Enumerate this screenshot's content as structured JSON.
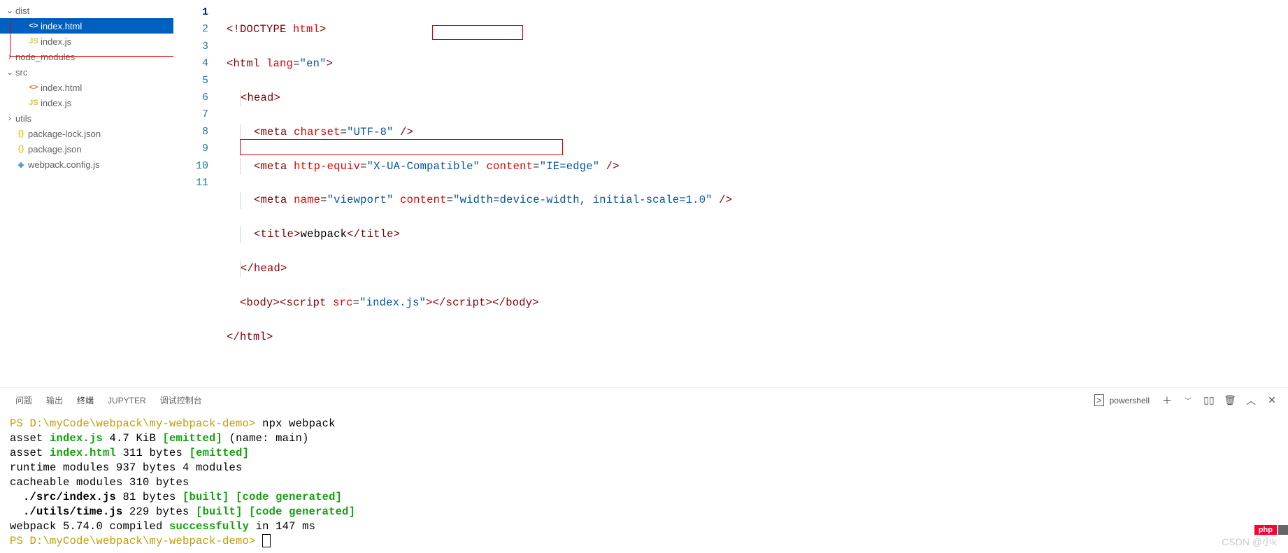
{
  "sidebar": {
    "items": [
      {
        "type": "folder",
        "label": "dist",
        "expanded": true,
        "indent": 0
      },
      {
        "type": "file",
        "label": "index.html",
        "icon": "html",
        "indent": 1,
        "selected": true
      },
      {
        "type": "file",
        "label": "index.js",
        "icon": "js",
        "indent": 1
      },
      {
        "type": "folder",
        "label": "node_modules",
        "expanded": false,
        "indent": 0
      },
      {
        "type": "folder",
        "label": "src",
        "expanded": true,
        "indent": 0
      },
      {
        "type": "file",
        "label": "index.html",
        "icon": "html",
        "indent": 1
      },
      {
        "type": "file",
        "label": "index.js",
        "icon": "js",
        "indent": 1
      },
      {
        "type": "folder",
        "label": "utils",
        "expanded": false,
        "indent": 0
      },
      {
        "type": "file",
        "label": "package-lock.json",
        "icon": "json",
        "indent": 0,
        "rootfile": true
      },
      {
        "type": "file",
        "label": "package.json",
        "icon": "json",
        "indent": 0,
        "rootfile": true
      },
      {
        "type": "file",
        "label": "webpack.config.js",
        "icon": "webpack",
        "indent": 0,
        "rootfile": true
      }
    ]
  },
  "editor": {
    "active_line": 1,
    "lines": [
      "1",
      "2",
      "3",
      "4",
      "5",
      "6",
      "7",
      "8",
      "9",
      "10",
      "11"
    ],
    "code": {
      "l1": {
        "doctype": "<!DOCTYPE ",
        "name": "html",
        "close": ">"
      },
      "l2": {
        "open": "<",
        "tag": "html",
        "sp": " ",
        "attr": "lang",
        "eq": "=",
        "val": "\"en\"",
        "close": ">"
      },
      "l3": {
        "open": "<",
        "tag": "head",
        "close": ">"
      },
      "l4": {
        "open": "<",
        "tag": "meta",
        "sp": " ",
        "attr": "charset",
        "eq": "=",
        "val": "\"UTF-8\"",
        "close": " />"
      },
      "l5": {
        "open": "<",
        "tag": "meta",
        "sp": " ",
        "a1": "http-equiv",
        "e1": "=",
        "v1": "\"X-UA-Compatible\"",
        "sp2": " ",
        "a2": "content",
        "e2": "=",
        "v2": "\"IE=edge\"",
        "close": " />"
      },
      "l6": {
        "open": "<",
        "tag": "meta",
        "sp": " ",
        "a1": "name",
        "e1": "=",
        "v1": "\"viewport\"",
        "sp2": " ",
        "a2": "content",
        "e2": "=",
        "v2": "\"width=device-width, initial-scale=1.0\"",
        "close": " />"
      },
      "l7": {
        "open1": "<",
        "tag1": "title",
        "close1": ">",
        "text": "webpack",
        "open2": "</",
        "tag2": "title",
        "close2": ">"
      },
      "l8": {
        "open": "</",
        "tag": "head",
        "close": ">"
      },
      "l9": {
        "p1": "<",
        "t1": "body",
        "p2": "><",
        "t2": "script",
        "sp": " ",
        "a": "src",
        "e": "=",
        "v": "\"index.js\"",
        "p3": "></",
        "t3": "script",
        "p4": "></",
        "t4": "body",
        "p5": ">"
      },
      "l10": {
        "open": "</",
        "tag": "html",
        "close": ">"
      }
    }
  },
  "panel": {
    "tabs": [
      "问题",
      "输出",
      "终端",
      "JUPYTER",
      "调试控制台"
    ],
    "active_tab": 2,
    "shell_label": "powershell",
    "terminal": {
      "prompt1": "PS D:\\myCode\\webpack\\my-webpack-demo>",
      "cmd1": " npx webpack",
      "l2a": "asset ",
      "l2b": "index.js",
      "l2c": " 4.7 KiB ",
      "l2d": "[emitted]",
      "l2e": " (name: main)",
      "l3a": "asset ",
      "l3b": "index.html",
      "l3c": " 311 bytes ",
      "l3d": "[emitted]",
      "l4": "runtime modules 937 bytes 4 modules",
      "l5": "cacheable modules 310 bytes",
      "l6a": "  ./src/index.js",
      "l6b": " 81 bytes ",
      "l6c": "[built]",
      "l6d": " ",
      "l6e": "[code generated]",
      "l7a": "  ./utils/time.js",
      "l7b": " 229 bytes ",
      "l7c": "[built]",
      "l7d": " ",
      "l7e": "[code generated]",
      "l8a": "webpack 5.74.0 compiled ",
      "l8b": "successfully",
      "l8c": " in 147 ms",
      "prompt2": "PS D:\\myCode\\webpack\\my-webpack-demo> "
    }
  },
  "watermarks": {
    "csdn": "CSDN @小k",
    "php": "php"
  }
}
